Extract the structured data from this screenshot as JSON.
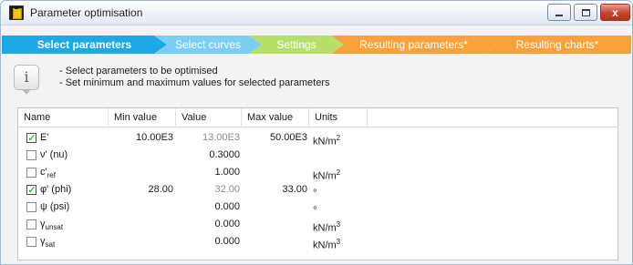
{
  "window": {
    "title": "Parameter optimisation",
    "close_glyph": "x",
    "icon": "app-icon"
  },
  "tabs": [
    {
      "label": "Select parameters",
      "active": true,
      "color": "#1ea9e6"
    },
    {
      "label": "Select curves",
      "active": false,
      "color": "#7ccff2"
    },
    {
      "label": "Settings",
      "active": false,
      "color": "#b6e06a"
    },
    {
      "label": "Resulting parameters*",
      "active": false,
      "color": "#f7a33a"
    },
    {
      "label": "Resulting charts*",
      "active": false,
      "color": "#f7a33a"
    }
  ],
  "info": {
    "icon": "info-icon",
    "icon_glyph": "i",
    "line1": "- Select parameters to be optimised",
    "line2": "- Set minimum and maximum values for selected parameters"
  },
  "table": {
    "columns": [
      "Name",
      "Min value",
      "Value",
      "Max value",
      "Units"
    ],
    "check_glyph": "✓",
    "rows": [
      {
        "name": "E'",
        "sub": "",
        "checked": true,
        "min": "10.00E3",
        "value": "13.00E3",
        "value_dim": true,
        "max": "50.00E3",
        "unit": "kN/m",
        "unit_sup": "2"
      },
      {
        "name": "ν' (nu)",
        "sub": "",
        "checked": false,
        "min": "",
        "value": "0.3000",
        "value_dim": false,
        "max": "",
        "unit": "",
        "unit_sup": ""
      },
      {
        "name": "c'",
        "sub": "ref",
        "checked": false,
        "min": "",
        "value": "1.000",
        "value_dim": false,
        "max": "",
        "unit": "kN/m",
        "unit_sup": "2"
      },
      {
        "name": "φ' (phi)",
        "sub": "",
        "checked": true,
        "min": "28.00",
        "value": "32.00",
        "value_dim": true,
        "max": "33.00",
        "unit": "°",
        "unit_sup": ""
      },
      {
        "name": "ψ (psi)",
        "sub": "",
        "checked": false,
        "min": "",
        "value": "0.000",
        "value_dim": false,
        "max": "",
        "unit": "°",
        "unit_sup": ""
      },
      {
        "name": "γ",
        "sub": "unsat",
        "checked": false,
        "min": "",
        "value": "0.000",
        "value_dim": false,
        "max": "",
        "unit": "kN/m",
        "unit_sup": "3"
      },
      {
        "name": "γ",
        "sub": "sat",
        "checked": false,
        "min": "",
        "value": "0.000",
        "value_dim": false,
        "max": "",
        "unit": "kN/m",
        "unit_sup": "3"
      }
    ]
  }
}
